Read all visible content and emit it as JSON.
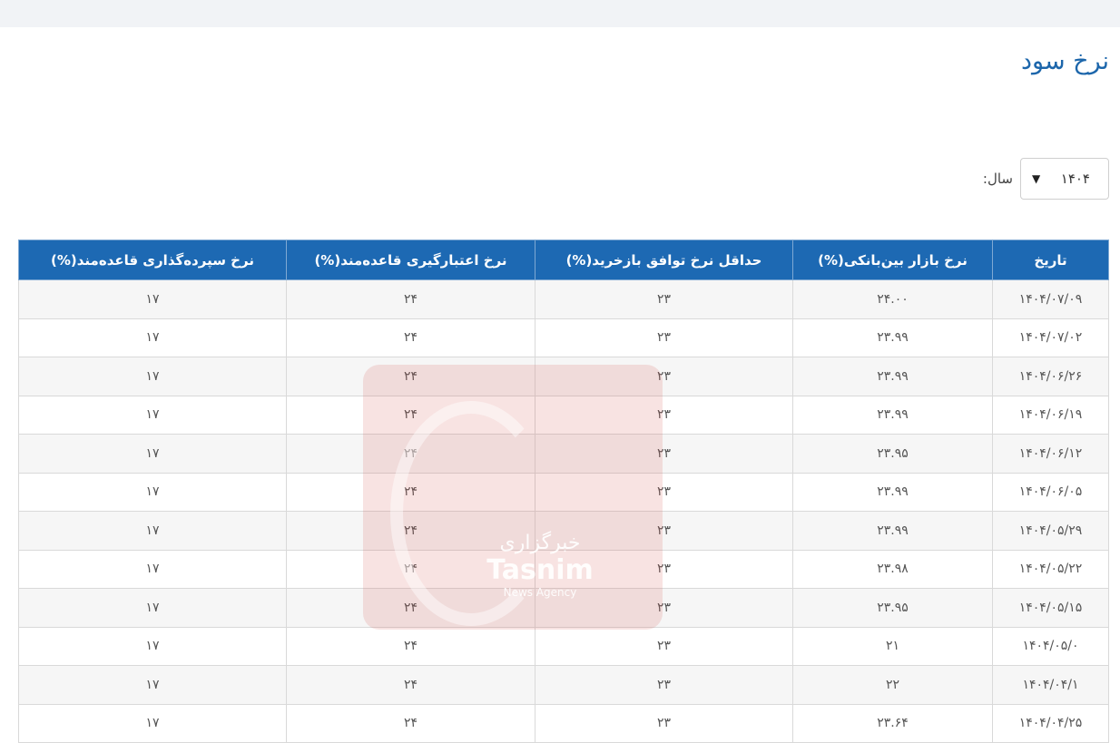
{
  "page": {
    "title": "نرخ سود"
  },
  "filter": {
    "year_label": "سال:",
    "year_value": "۱۴۰۴"
  },
  "table": {
    "headers": [
      "تاریخ",
      "نرخ بازار بین‌بانکی(%)",
      "حداقل نرخ توافق بازخرید(%)",
      "نرخ اعتبارگیری قاعده‌مند(%)",
      "نرخ سپرده‌گذاری قاعده‌مند(%)"
    ],
    "rows": [
      [
        "۱۴۰۴/۰۷/۰۹",
        "۲۴.۰۰",
        "۲۳",
        "۲۴",
        "۱۷"
      ],
      [
        "۱۴۰۴/۰۷/۰۲",
        "۲۳.۹۹",
        "۲۳",
        "۲۴",
        "۱۷"
      ],
      [
        "۱۴۰۴/۰۶/۲۶",
        "۲۳.۹۹",
        "۲۳",
        "۲۴",
        "۱۷"
      ],
      [
        "۱۴۰۴/۰۶/۱۹",
        "۲۳.۹۹",
        "۲۳",
        "۲۴",
        "۱۷"
      ],
      [
        "۱۴۰۴/۰۶/۱۲",
        "۲۳.۹۵",
        "۲۳",
        "۲۴",
        "۱۷"
      ],
      [
        "۱۴۰۴/۰۶/۰۵",
        "۲۳.۹۹",
        "۲۳",
        "۲۴",
        "۱۷"
      ],
      [
        "۱۴۰۴/۰۵/۲۹",
        "۲۳.۹۹",
        "۲۳",
        "۲۴",
        "۱۷"
      ],
      [
        "۱۴۰۴/۰۵/۲۲",
        "۲۳.۹۸",
        "۲۳",
        "۲۴",
        "۱۷"
      ],
      [
        "۱۴۰۴/۰۵/۱۵",
        "۲۳.۹۵",
        "۲۳",
        "۲۴",
        "۱۷"
      ],
      [
        "۱۴۰۴/۰۵/۰",
        "۲۱",
        "۲۳",
        "۲۴",
        "۱۷"
      ],
      [
        "۱۴۰۴/۰۴/۱",
        "۲۲",
        "۲۳",
        "۲۴",
        "۱۷"
      ],
      [
        "۱۴۰۴/۰۴/۲۵",
        "۲۳.۶۴",
        "۲۳",
        "۲۴",
        "۱۷"
      ]
    ]
  },
  "watermark": {
    "line1": "خبرگزاری",
    "line2": "Tasnim",
    "line3": "News Agency"
  }
}
